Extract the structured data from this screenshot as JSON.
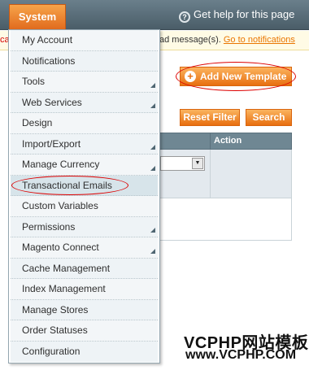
{
  "header": {
    "system_tab": "System",
    "help_text": "Get help for this page"
  },
  "message_bar": {
    "left_text": "ca",
    "right_text": "ad message(s).",
    "link_text": "Go to notifications"
  },
  "actions": {
    "add_new_template": "Add New Template",
    "reset_filter": "Reset Filter",
    "search": "Search"
  },
  "grid": {
    "action_header": "Action"
  },
  "system_menu": {
    "items": [
      {
        "label": "My Account",
        "submenu": false
      },
      {
        "label": "Notifications",
        "submenu": false
      },
      {
        "label": "Tools",
        "submenu": true
      },
      {
        "label": "Web Services",
        "submenu": true
      },
      {
        "label": "Design",
        "submenu": false
      },
      {
        "label": "Import/Export",
        "submenu": true
      },
      {
        "label": "Manage Currency",
        "submenu": true
      },
      {
        "label": "Transactional Emails",
        "submenu": false,
        "highlighted": true
      },
      {
        "label": "Custom Variables",
        "submenu": false
      },
      {
        "label": "Permissions",
        "submenu": true
      },
      {
        "label": "Magento Connect",
        "submenu": true
      },
      {
        "label": "Cache Management",
        "submenu": false
      },
      {
        "label": "Index Management",
        "submenu": false
      },
      {
        "label": "Manage Stores",
        "submenu": false
      },
      {
        "label": "Order Statuses",
        "submenu": false
      },
      {
        "label": "Configuration",
        "submenu": false
      }
    ]
  },
  "watermark": {
    "line1": "VCPHP网站模板",
    "line2": "www.VCPHP.COM"
  },
  "colors": {
    "accent_orange": "#e86f10",
    "header_slate": "#5a6e79",
    "annotation_red": "#dd0000"
  }
}
